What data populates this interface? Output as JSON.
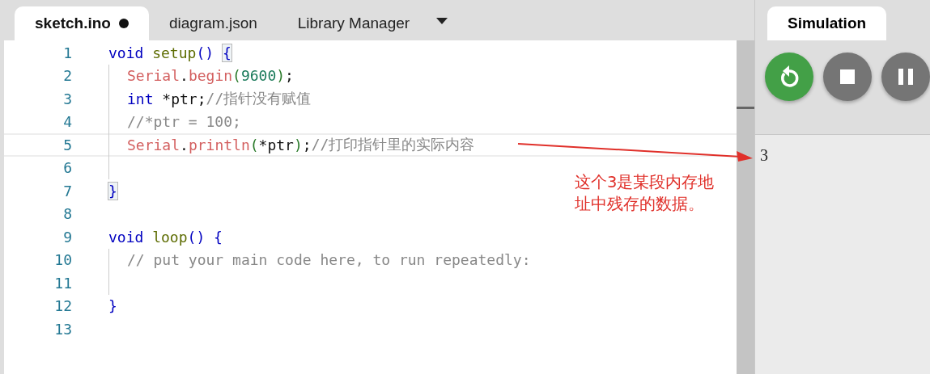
{
  "editor": {
    "tabs": [
      {
        "label": "sketch.ino",
        "selected": true,
        "modified": true
      },
      {
        "label": "diagram.json",
        "selected": false,
        "modified": false
      },
      {
        "label": "Library Manager",
        "selected": false,
        "modified": false
      }
    ],
    "lines": [
      {
        "number": "1",
        "active": false,
        "indented": false,
        "tokens": [
          {
            "kind": "keyword",
            "text": "void"
          },
          {
            "kind": "function",
            "text": " setup"
          },
          {
            "kind": "bracket",
            "text": "() "
          },
          {
            "kind": "match",
            "text": "{"
          }
        ]
      },
      {
        "number": "2",
        "active": false,
        "indented": true,
        "tokens": [
          {
            "kind": "object",
            "text": "Serial"
          },
          {
            "kind": "plain",
            "text": "."
          },
          {
            "kind": "object",
            "text": "begin"
          },
          {
            "kind": "paren",
            "text": "("
          },
          {
            "kind": "number",
            "text": "9600"
          },
          {
            "kind": "paren",
            "text": ")"
          },
          {
            "kind": "plain",
            "text": ";"
          }
        ]
      },
      {
        "number": "3",
        "active": false,
        "indented": true,
        "tokens": [
          {
            "kind": "keyword",
            "text": "int"
          },
          {
            "kind": "plain",
            "text": " *ptr;"
          },
          {
            "kind": "comment",
            "text": "//指针没有赋值"
          }
        ]
      },
      {
        "number": "4",
        "active": false,
        "indented": true,
        "tokens": [
          {
            "kind": "comment",
            "text": "//*ptr = 100;"
          }
        ]
      },
      {
        "number": "5",
        "active": true,
        "indented": true,
        "tokens": [
          {
            "kind": "object",
            "text": "Serial"
          },
          {
            "kind": "plain",
            "text": "."
          },
          {
            "kind": "object",
            "text": "println"
          },
          {
            "kind": "paren",
            "text": "("
          },
          {
            "kind": "plain",
            "text": "*ptr"
          },
          {
            "kind": "paren",
            "text": ")"
          },
          {
            "kind": "plain",
            "text": ";"
          },
          {
            "kind": "comment",
            "text": "//打印指针里的实际内容"
          }
        ]
      },
      {
        "number": "6",
        "active": false,
        "indented": true
      },
      {
        "number": "7",
        "active": false,
        "indented": false,
        "tokens": [
          {
            "kind": "match",
            "text": "}"
          }
        ]
      },
      {
        "number": "8",
        "active": false,
        "indented": false
      },
      {
        "number": "9",
        "active": false,
        "indented": false,
        "tokens": [
          {
            "kind": "keyword",
            "text": "void"
          },
          {
            "kind": "function",
            "text": " loop"
          },
          {
            "kind": "bracket",
            "text": "() {"
          }
        ]
      },
      {
        "number": "10",
        "active": false,
        "indented": true,
        "tokens": [
          {
            "kind": "comment",
            "text": "// put your main code here, to run repeatedly:"
          }
        ]
      },
      {
        "number": "11",
        "active": false,
        "indented": true
      },
      {
        "number": "12",
        "active": false,
        "indented": false,
        "tokens": [
          {
            "kind": "bracket",
            "text": "}"
          }
        ]
      },
      {
        "number": "13",
        "active": false,
        "indented": false
      }
    ]
  },
  "simulation": {
    "tab": {
      "label": "Simulation",
      "selected": true
    },
    "controls": [
      {
        "kind": "restart"
      },
      {
        "kind": "stop"
      },
      {
        "kind": "pause"
      }
    ],
    "serial_output": "3"
  },
  "annotation": {
    "text": "这个3是某段内存地址中残存的数据。"
  }
}
